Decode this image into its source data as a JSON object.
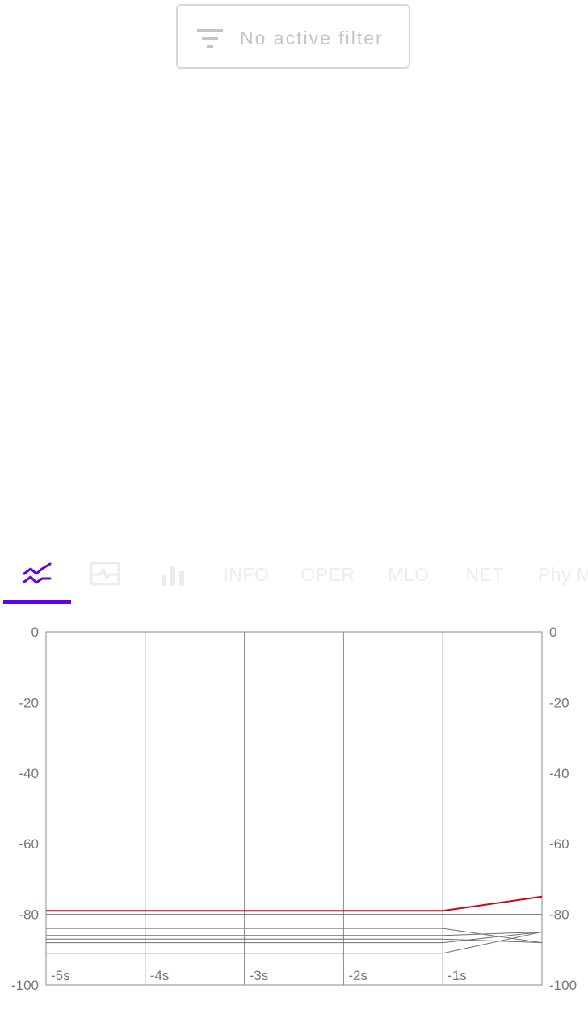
{
  "filter": {
    "label": "No active filter",
    "icon": "filter-list-icon"
  },
  "tabs": [
    {
      "icon": "signal-wave-icon",
      "active": true
    },
    {
      "icon": "monitor-pulse-icon",
      "active": false
    },
    {
      "icon": "bar-chart-icon",
      "active": false
    },
    {
      "label": "INFO",
      "active": false
    },
    {
      "label": "OPER",
      "active": false
    },
    {
      "label": "MLO",
      "active": false
    },
    {
      "label": "NET",
      "active": false
    },
    {
      "label": "Phy M",
      "active": false
    }
  ],
  "colors": {
    "accent": "#6200ea",
    "highlight_series": "#d0021b",
    "series": "#6e6e6e",
    "grid": "#8a8a8a",
    "tab_inactive": "#ececec"
  },
  "chart_data": {
    "type": "line",
    "x": [
      -5.5,
      -4.5,
      -3.5,
      -2.5,
      -1.5,
      -0.5
    ],
    "xticks": [
      "-5s",
      "-4s",
      "-3s",
      "-2s",
      "-1s"
    ],
    "xlim": [
      -5.5,
      -0.5
    ],
    "ylim": [
      -100,
      0
    ],
    "yticks": [
      "0",
      "-20",
      "-40",
      "-60",
      "-80",
      "-100"
    ],
    "grid": true,
    "series": [
      {
        "values": [
          -79,
          -79,
          -79,
          -79,
          -79,
          -75
        ],
        "highlight": true
      },
      {
        "values": [
          -80,
          -80,
          -80,
          -80,
          -80,
          -80
        ]
      },
      {
        "values": [
          -84,
          -84,
          -84,
          -84,
          -84,
          -88
        ]
      },
      {
        "values": [
          -86,
          -86,
          -86,
          -86,
          -86,
          -85
        ]
      },
      {
        "values": [
          -87,
          -87,
          -87,
          -87,
          -87,
          -88
        ]
      },
      {
        "values": [
          -88,
          -88,
          -88,
          -88,
          -88,
          -85
        ]
      },
      {
        "values": [
          -91,
          -91,
          -91,
          -91,
          -91,
          -85
        ]
      }
    ]
  }
}
